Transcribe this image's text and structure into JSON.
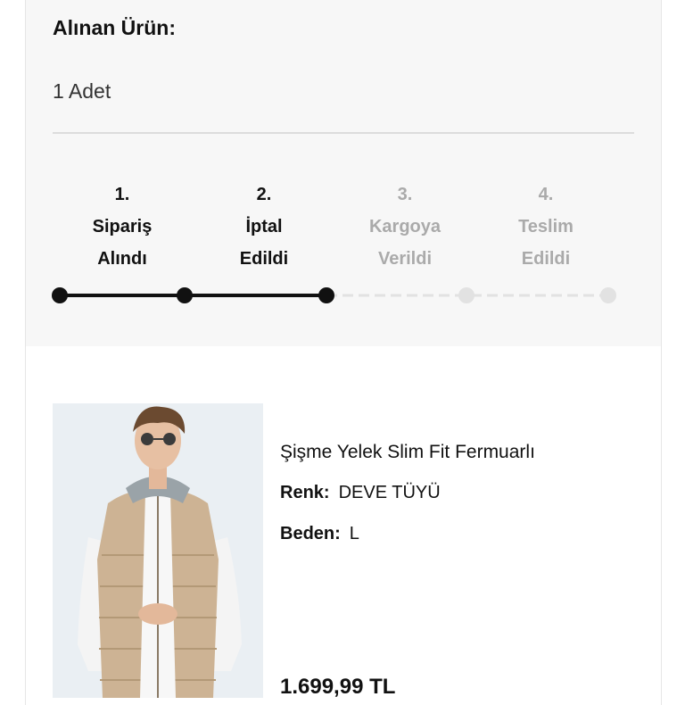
{
  "order": {
    "item_label": "Alınan Ürün:",
    "quantity": "1 Adet"
  },
  "steps": [
    {
      "number": "1.",
      "line1": "Sipariş",
      "line2": "Alındı",
      "status": "done"
    },
    {
      "number": "2.",
      "line1": "İptal",
      "line2": "Edildi",
      "status": "done"
    },
    {
      "number": "3.",
      "line1": "Kargoya",
      "line2": "Verildi",
      "status": "pending"
    },
    {
      "number": "4.",
      "line1": "Teslim",
      "line2": "Edildi",
      "status": "pending"
    }
  ],
  "product": {
    "name": "Şişme Yelek Slim Fit Fermuarlı",
    "color_key": "Renk:",
    "color_value": "DEVE TÜYÜ",
    "size_key": "Beden:",
    "size_value": "L",
    "price": "1.699,99 TL",
    "image": "man-in-beige-puffer-vest-photo"
  },
  "colors": {
    "active": "#111111",
    "inactive": "#e2e2e2",
    "inactive_text": "#aaaaaa",
    "panel_bg": "#f7f7f7"
  }
}
